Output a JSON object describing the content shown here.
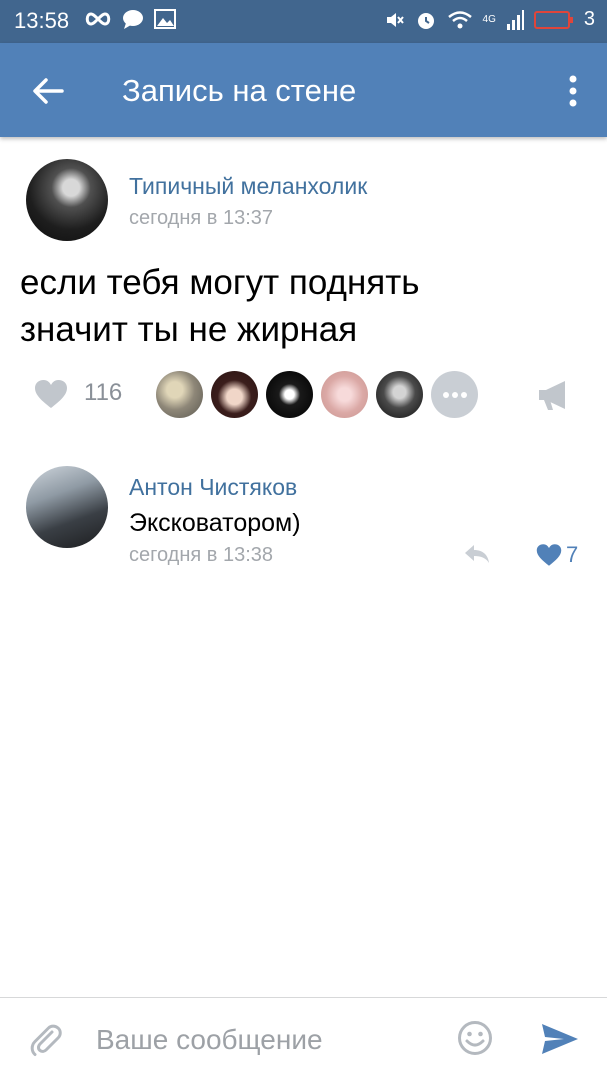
{
  "status_bar": {
    "time": "13:58",
    "battery_level": "3",
    "network": "4G",
    "icons": [
      "infinity-icon",
      "chat-bubble-icon",
      "image-icon",
      "mute-icon",
      "alarm-icon",
      "wifi-icon",
      "signal-icon",
      "battery-icon"
    ]
  },
  "header": {
    "title": "Запись на стене",
    "back_icon": "back-arrow-icon",
    "menu_icon": "more-vertical-icon"
  },
  "post": {
    "author": "Типичный меланхолик",
    "time": "сегодня в 13:37",
    "text_lines": [
      "если тебя могут поднять",
      "значит ты не жирная"
    ],
    "likes_count": "116",
    "likers": [
      {
        "name": "liker-avatar-1",
        "color": "#9c9586"
      },
      {
        "name": "liker-avatar-2",
        "color": "#4a3030"
      },
      {
        "name": "liker-avatar-3",
        "color": "#111111"
      },
      {
        "name": "liker-avatar-4",
        "color": "#e2b9b6"
      },
      {
        "name": "liker-avatar-5",
        "color": "#3a3a3a"
      }
    ],
    "share_icon": "megaphone-icon"
  },
  "comment": {
    "author": "Антон Чистяков",
    "text": "Эксковатором)",
    "time": "сегодня в 13:38",
    "likes_count": "7",
    "reply_icon": "reply-icon"
  },
  "composer": {
    "placeholder": "Ваше сообщение",
    "value": ""
  },
  "colors": {
    "accent": "#5181b8",
    "status_bar": "#41668e",
    "link": "#41719e",
    "secondary_text": "#a3a7ac"
  }
}
